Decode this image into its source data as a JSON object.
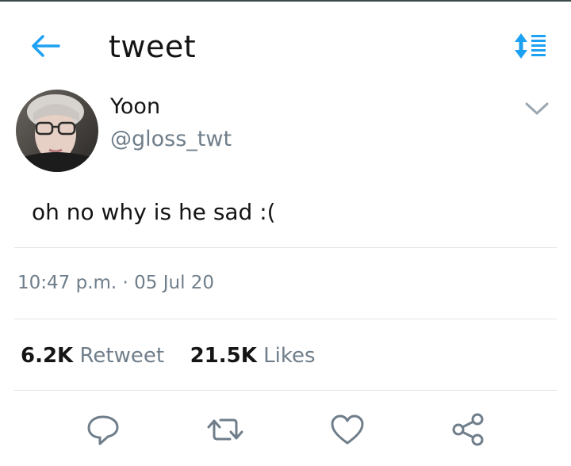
{
  "header": {
    "title": "tweet",
    "back_icon": "arrow-left-icon",
    "sort_icon": "sort-list-icon"
  },
  "colors": {
    "accent": "#1da1f2",
    "muted": "#6f7e8a",
    "divider": "#e1e6ea"
  },
  "tweet": {
    "author_name": "Yoon",
    "author_handle": "@gloss_twt",
    "text": "oh no why is he sad :(",
    "timestamp": "10:47 p.m. · 05 Jul 20",
    "retweet_count": "6.2K",
    "retweet_label": "Retweet",
    "like_count": "21.5K",
    "like_label": "Likes"
  },
  "actions": [
    "reply-icon",
    "retweet-icon",
    "like-icon",
    "share-icon"
  ]
}
